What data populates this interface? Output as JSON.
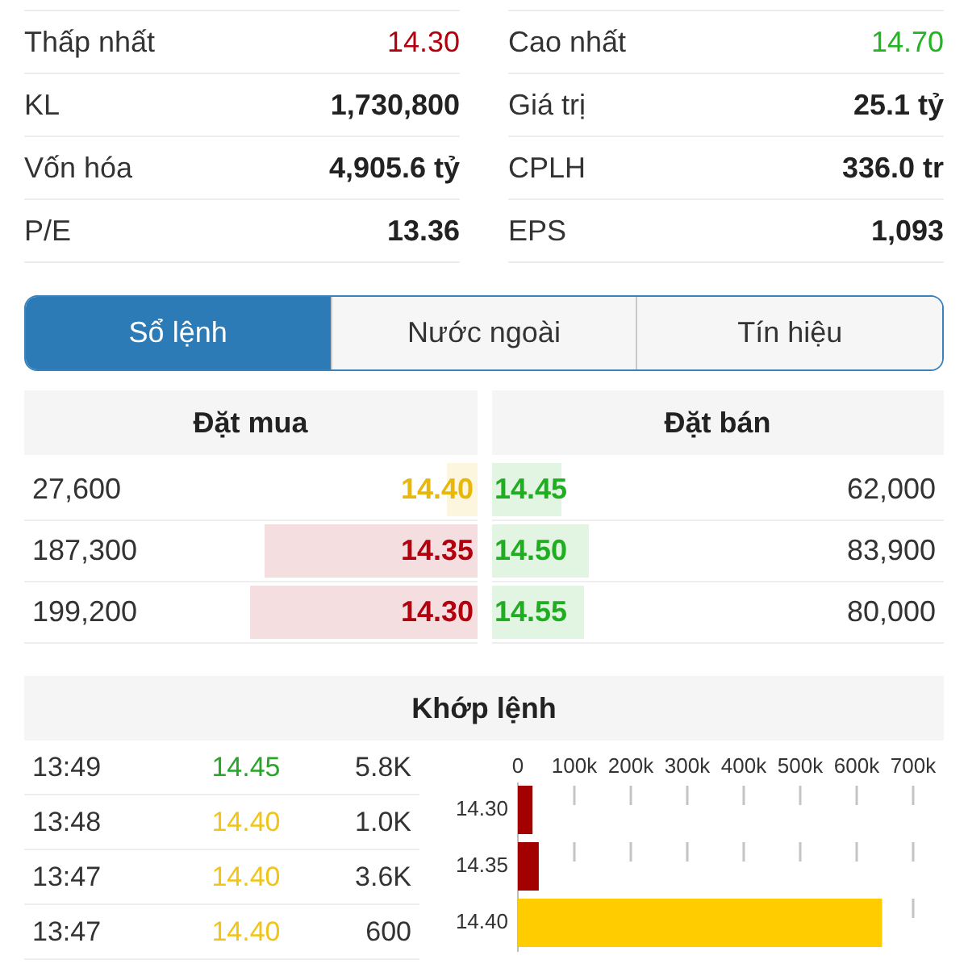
{
  "stats": [
    {
      "label": "Thấp nhất",
      "value": "14.30",
      "color": "#b3000f"
    },
    {
      "label": "Cao nhất",
      "value": "14.70",
      "color": "#22b422"
    },
    {
      "label": "KL",
      "value": "1,730,800"
    },
    {
      "label": "Giá trị",
      "value": "25.1 tỷ"
    },
    {
      "label": "Vốn hóa",
      "value": "4,905.6 tỷ"
    },
    {
      "label": "CPLH",
      "value": "336.0 tr"
    },
    {
      "label": "P/E",
      "value": "13.36"
    },
    {
      "label": "EPS",
      "value": "1,093"
    }
  ],
  "tabs": [
    {
      "label": "Sổ lệnh",
      "selected": true
    },
    {
      "label": "Nước ngoài",
      "selected": false
    },
    {
      "label": "Tín hiệu",
      "selected": false
    }
  ],
  "order_book": {
    "bid_header": "Đặt mua",
    "ask_header": "Đặt bán",
    "bids": [
      {
        "volume": "27,600",
        "price": "14.40",
        "color": "#e8b70c",
        "level": 0.065
      },
      {
        "volume": "187,300",
        "price": "14.35",
        "color": "#b3000f",
        "level": 0.47
      },
      {
        "volume": "199,200",
        "price": "14.30",
        "color": "#b3000f",
        "level": 0.5
      }
    ],
    "asks": [
      {
        "price": "14.45",
        "volume": "62,000",
        "color": "#1fae1f",
        "level": 0.155
      },
      {
        "price": "14.50",
        "volume": "83,900",
        "color": "#1fae1f",
        "level": 0.215
      },
      {
        "price": "14.55",
        "volume": "80,000",
        "color": "#1fae1f",
        "level": 0.205
      }
    ]
  },
  "matched": {
    "title": "Khớp lệnh",
    "trades": [
      {
        "time": "13:49",
        "price": "14.45",
        "color": "#2aa52a",
        "volume": "5.8K"
      },
      {
        "time": "13:48",
        "price": "14.40",
        "color": "#f0c419",
        "volume": "1.0K"
      },
      {
        "time": "13:47",
        "price": "14.40",
        "color": "#f0c419",
        "volume": "3.6K"
      },
      {
        "time": "13:47",
        "price": "14.40",
        "color": "#f0c419",
        "volume": "600"
      }
    ],
    "chart_data": {
      "type": "bar",
      "orientation": "horizontal",
      "grid": true,
      "categories": [
        "14.30",
        "14.35",
        "14.40"
      ],
      "values": [
        26000,
        37000,
        645000
      ],
      "colors": [
        "#a30000",
        "#a30000",
        "#ffcc00"
      ],
      "xlim": [
        0,
        700000
      ],
      "xticks": [
        {
          "value": 0,
          "label": "0"
        },
        {
          "value": 100000,
          "label": "100k"
        },
        {
          "value": 200000,
          "label": "200k"
        },
        {
          "value": 300000,
          "label": "300k"
        },
        {
          "value": 400000,
          "label": "400k"
        },
        {
          "value": 500000,
          "label": "500k"
        },
        {
          "value": 600000,
          "label": "600k"
        },
        {
          "value": 700000,
          "label": "700k"
        }
      ]
    }
  }
}
